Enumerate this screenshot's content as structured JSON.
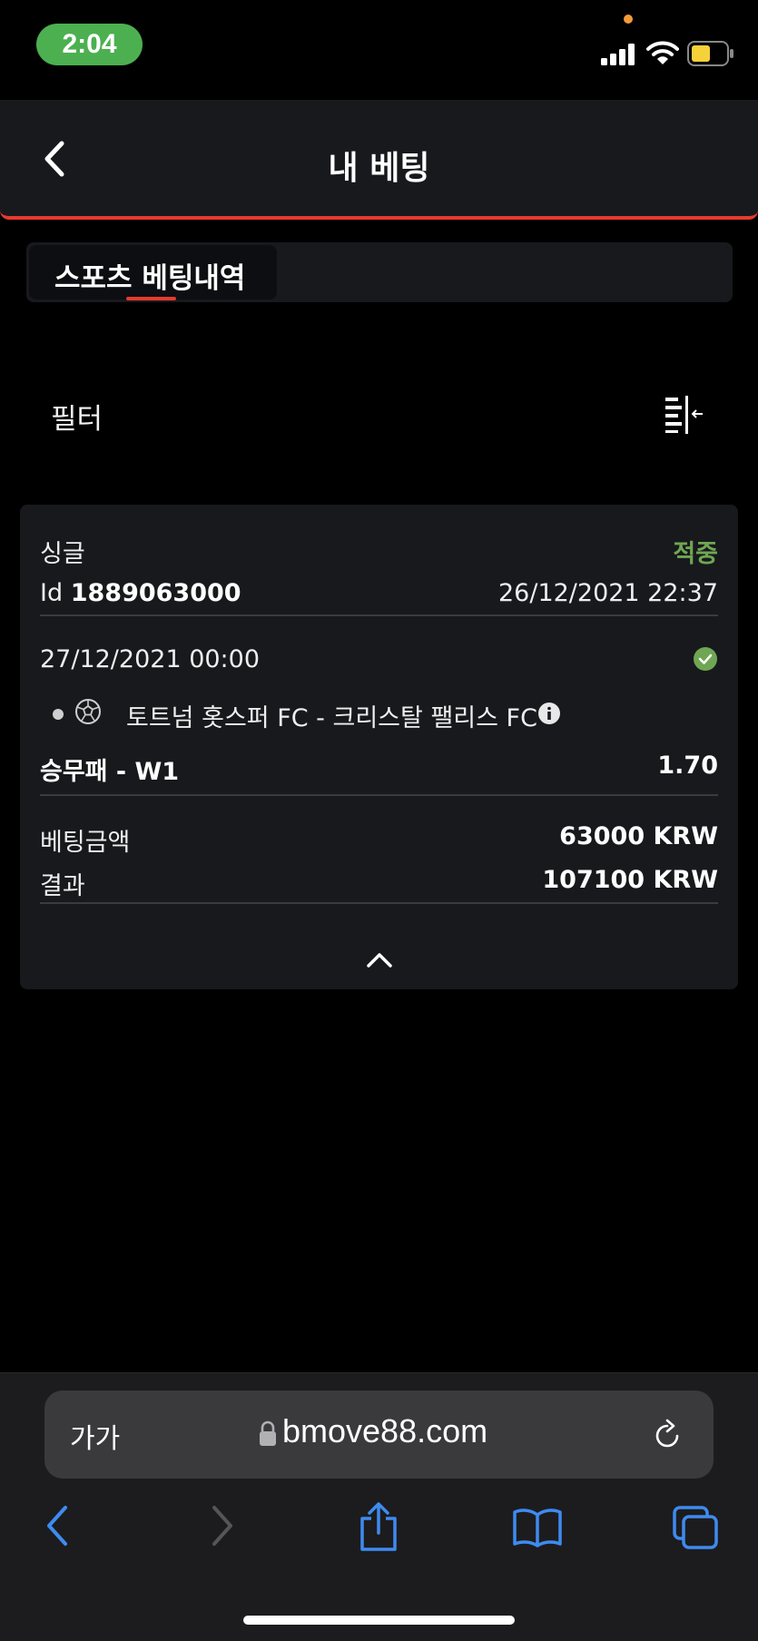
{
  "status_bar": {
    "time": "2:04"
  },
  "header": {
    "title": "내 베팅"
  },
  "tabs": {
    "active_label": "스포츠 베팅내역"
  },
  "filter": {
    "label": "필터"
  },
  "bet": {
    "type": "싱글",
    "status": "적중",
    "id_prefix": "Id",
    "id": "1889063000",
    "placed_at": "26/12/2021 22:37",
    "event_date": "27/12/2021 00:00",
    "match": "토트넘 홋스퍼 FC - 크리스탈 팰리스 FC",
    "market": "승무패 - W1",
    "odds": "1.70",
    "stake_label": "베팅금액",
    "stake": "63000 KRW",
    "result_label": "결과",
    "result": "107100 KRW"
  },
  "browser": {
    "aa_label": "가가",
    "url": "bmove88.com"
  },
  "colors": {
    "accent_red": "#e53a2f",
    "win_green": "#6fa653",
    "time_pill": "#4cb050",
    "nav_blue": "#3e8bf0"
  }
}
